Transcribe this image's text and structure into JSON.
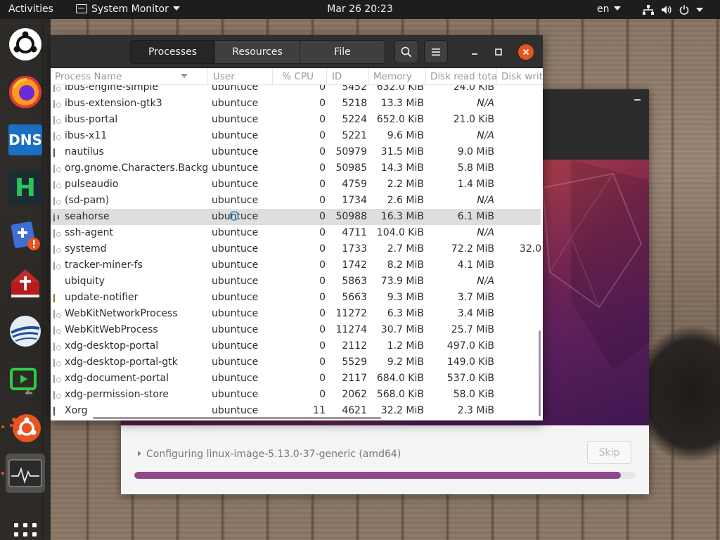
{
  "topbar": {
    "activities": "Activities",
    "app_name": "System Monitor",
    "clock": "Mar 26  20:23",
    "lang": "en"
  },
  "dock": {
    "icons": [
      "ubuntu-logo-icon",
      "firefox-icon",
      "dns-app-icon",
      "h-app-icon",
      "update-app-icon",
      "bible-app-icon",
      "app-icon",
      "media-app-icon",
      "ubiquity-installer-icon",
      "system-monitor-icon",
      "show-apps-icon"
    ],
    "dns_label": "DNS",
    "h_label": "H"
  },
  "installer": {
    "status": "Configuring linux-image-5.13.0-37-generic (amd64)",
    "skip_label": "Skip",
    "progress_percent": 97,
    "accent": "#91498d"
  },
  "sysmon": {
    "tabs": [
      {
        "label": "Processes",
        "active": true
      },
      {
        "label": "Resources",
        "active": false
      },
      {
        "label": "File Systems",
        "active": false
      }
    ],
    "columns": {
      "name": "Process Name",
      "user": "User",
      "cpu": "% CPU",
      "id": "ID",
      "memory": "Memory",
      "disk_read": "Disk read total",
      "disk_write": "Disk write total"
    },
    "rows": [
      {
        "name": "ibus-engine-simple",
        "user": "ubuntuce",
        "cpu": "0",
        "id": "5452",
        "memory": "632.0 KiB",
        "disk_read": "24.0 KiB",
        "disk_write": "",
        "icon": "proc-icon"
      },
      {
        "name": "ibus-extension-gtk3",
        "user": "ubuntuce",
        "cpu": "0",
        "id": "5218",
        "memory": "13.3 MiB",
        "disk_read": "N/A",
        "disk_write": "",
        "icon": "proc-icon"
      },
      {
        "name": "ibus-portal",
        "user": "ubuntuce",
        "cpu": "0",
        "id": "5224",
        "memory": "652.0 KiB",
        "disk_read": "21.0 KiB",
        "disk_write": "",
        "icon": "proc-icon"
      },
      {
        "name": "ibus-x11",
        "user": "ubuntuce",
        "cpu": "0",
        "id": "5221",
        "memory": "9.6 MiB",
        "disk_read": "N/A",
        "disk_write": "",
        "icon": "proc-icon"
      },
      {
        "name": "nautilus",
        "user": "ubuntuce",
        "cpu": "0",
        "id": "50979",
        "memory": "31.5 MiB",
        "disk_read": "9.0 MiB",
        "disk_write": "",
        "icon": "folder-icon"
      },
      {
        "name": "org.gnome.Characters.BackgroundService",
        "user": "ubuntuce",
        "cpu": "0",
        "id": "50985",
        "memory": "14.3 MiB",
        "disk_read": "5.8 MiB",
        "disk_write": "",
        "icon": "proc-icon"
      },
      {
        "name": "pulseaudio",
        "user": "ubuntuce",
        "cpu": "0",
        "id": "4759",
        "memory": "2.2 MiB",
        "disk_read": "1.4 MiB",
        "disk_write": "",
        "icon": "proc-icon"
      },
      {
        "name": "(sd-pam)",
        "user": "ubuntuce",
        "cpu": "0",
        "id": "1734",
        "memory": "2.6 MiB",
        "disk_read": "N/A",
        "disk_write": "",
        "icon": "proc-icon"
      },
      {
        "name": "seahorse",
        "user": "ubuntuce",
        "cpu": "0",
        "id": "50988",
        "memory": "16.3 MiB",
        "disk_read": "6.1 MiB",
        "disk_write": "",
        "icon": "seahorse-icon",
        "selected": true
      },
      {
        "name": "ssh-agent",
        "user": "ubuntuce",
        "cpu": "0",
        "id": "4711",
        "memory": "104.0 KiB",
        "disk_read": "N/A",
        "disk_write": "",
        "icon": "proc-icon"
      },
      {
        "name": "systemd",
        "user": "ubuntuce",
        "cpu": "0",
        "id": "1733",
        "memory": "2.7 MiB",
        "disk_read": "72.2 MiB",
        "disk_write": "32.0",
        "icon": "proc-icon"
      },
      {
        "name": "tracker-miner-fs",
        "user": "ubuntuce",
        "cpu": "0",
        "id": "1742",
        "memory": "8.2 MiB",
        "disk_read": "4.1 MiB",
        "disk_write": "",
        "icon": "proc-icon"
      },
      {
        "name": "ubiquity",
        "user": "ubuntuce",
        "cpu": "0",
        "id": "5863",
        "memory": "73.9 MiB",
        "disk_read": "N/A",
        "disk_write": "",
        "icon": "ubiquity-icon"
      },
      {
        "name": "update-notifier",
        "user": "ubuntuce",
        "cpu": "0",
        "id": "5663",
        "memory": "9.3 MiB",
        "disk_read": "3.7 MiB",
        "disk_write": "",
        "icon": "update-notifier-icon"
      },
      {
        "name": "WebKitNetworkProcess",
        "user": "ubuntuce",
        "cpu": "0",
        "id": "11272",
        "memory": "6.3 MiB",
        "disk_read": "3.4 MiB",
        "disk_write": "",
        "icon": "proc-icon"
      },
      {
        "name": "WebKitWebProcess",
        "user": "ubuntuce",
        "cpu": "0",
        "id": "11274",
        "memory": "30.7 MiB",
        "disk_read": "25.7 MiB",
        "disk_write": "",
        "icon": "proc-icon"
      },
      {
        "name": "xdg-desktop-portal",
        "user": "ubuntuce",
        "cpu": "0",
        "id": "2112",
        "memory": "1.2 MiB",
        "disk_read": "497.0 KiB",
        "disk_write": "",
        "icon": "proc-icon"
      },
      {
        "name": "xdg-desktop-portal-gtk",
        "user": "ubuntuce",
        "cpu": "0",
        "id": "5529",
        "memory": "9.2 MiB",
        "disk_read": "149.0 KiB",
        "disk_write": "",
        "icon": "proc-icon"
      },
      {
        "name": "xdg-document-portal",
        "user": "ubuntuce",
        "cpu": "0",
        "id": "2117",
        "memory": "684.0 KiB",
        "disk_read": "537.0 KiB",
        "disk_write": "",
        "icon": "proc-icon"
      },
      {
        "name": "xdg-permission-store",
        "user": "ubuntuce",
        "cpu": "0",
        "id": "2062",
        "memory": "568.0 KiB",
        "disk_read": "58.0 KiB",
        "disk_write": "",
        "icon": "proc-icon"
      },
      {
        "name": "Xorg",
        "user": "ubuntuce",
        "cpu": "11",
        "id": "4621",
        "memory": "32.2 MiB",
        "disk_read": "2.3 MiB",
        "disk_write": "",
        "icon": "xorg-icon"
      }
    ]
  },
  "colors": {
    "ubuntu_orange": "#e95420",
    "header_dark": "#2f2f2f",
    "selected_row": "#dedede"
  }
}
